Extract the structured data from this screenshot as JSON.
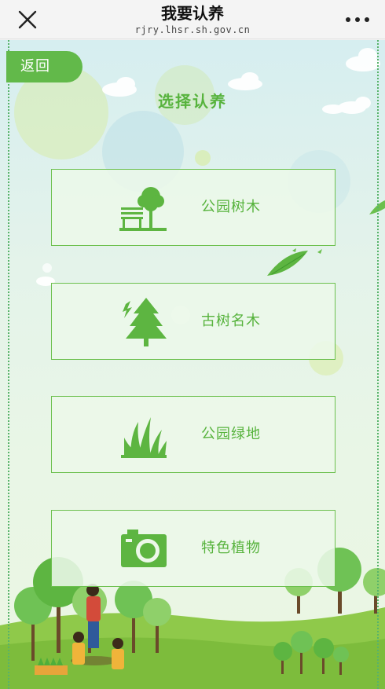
{
  "header": {
    "title": "我要认养",
    "url": "rjry.lhsr.sh.gov.cn"
  },
  "back_label": "返回",
  "heading": "选择认养",
  "options": [
    {
      "label": "公园树木",
      "icon": "park-tree-bench-icon"
    },
    {
      "label": "古树名木",
      "icon": "ancient-tree-icon"
    },
    {
      "label": "公园绿地",
      "icon": "grass-icon"
    },
    {
      "label": "特色植物",
      "icon": "camera-icon"
    }
  ],
  "colors": {
    "accent": "#62b94a",
    "text_green": "#57b33d",
    "border_green": "#6cc04e"
  }
}
